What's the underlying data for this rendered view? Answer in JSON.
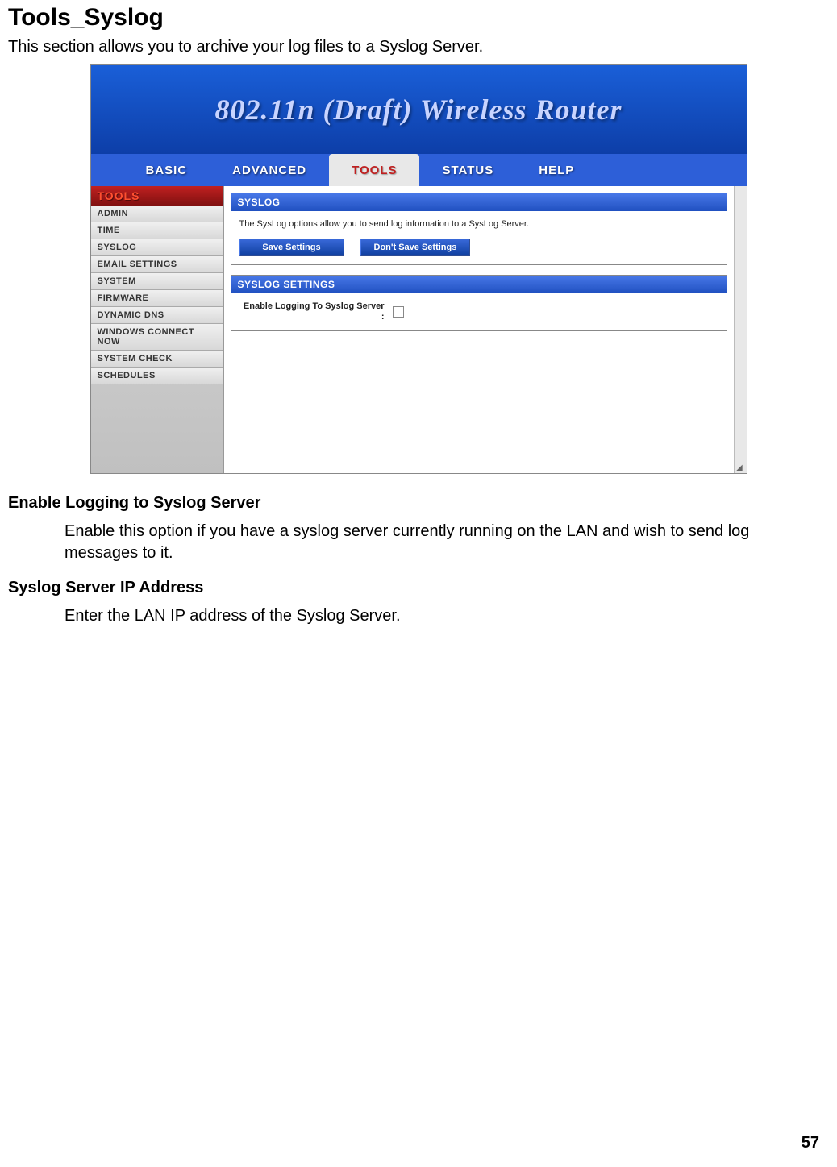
{
  "doc": {
    "title": "Tools_Syslog",
    "intro": "This section allows you to archive your log files to a Syslog Server.",
    "sections": [
      {
        "heading": "Enable Logging to Syslog Server",
        "body": "Enable this option if you have a syslog server currently running on the LAN and wish to send log messages to it."
      },
      {
        "heading": "Syslog Server IP Address",
        "body": "Enter the LAN IP address of the Syslog Server."
      }
    ],
    "page_number": "57"
  },
  "router_ui": {
    "banner": "802.11n (Draft) Wireless Router",
    "topnav": {
      "items": [
        "BASIC",
        "ADVANCED",
        "TOOLS",
        "STATUS",
        "HELP"
      ],
      "active_index": 2
    },
    "sidebar": {
      "header": "TOOLS",
      "items": [
        "ADMIN",
        "TIME",
        "SYSLOG",
        "EMAIL SETTINGS",
        "SYSTEM",
        "FIRMWARE",
        "DYNAMIC DNS",
        "WINDOWS CONNECT NOW",
        "SYSTEM CHECK",
        "SCHEDULES"
      ]
    },
    "panels": {
      "syslog": {
        "title": "SYSLOG",
        "desc": "The SysLog options allow you to send log information to a SysLog Server.",
        "buttons": {
          "save": "Save Settings",
          "dont_save": "Don't Save Settings"
        }
      },
      "settings": {
        "title": "SYSLOG SETTINGS",
        "enable_label": "Enable Logging To Syslog Server :",
        "enable_checked": false
      }
    }
  }
}
